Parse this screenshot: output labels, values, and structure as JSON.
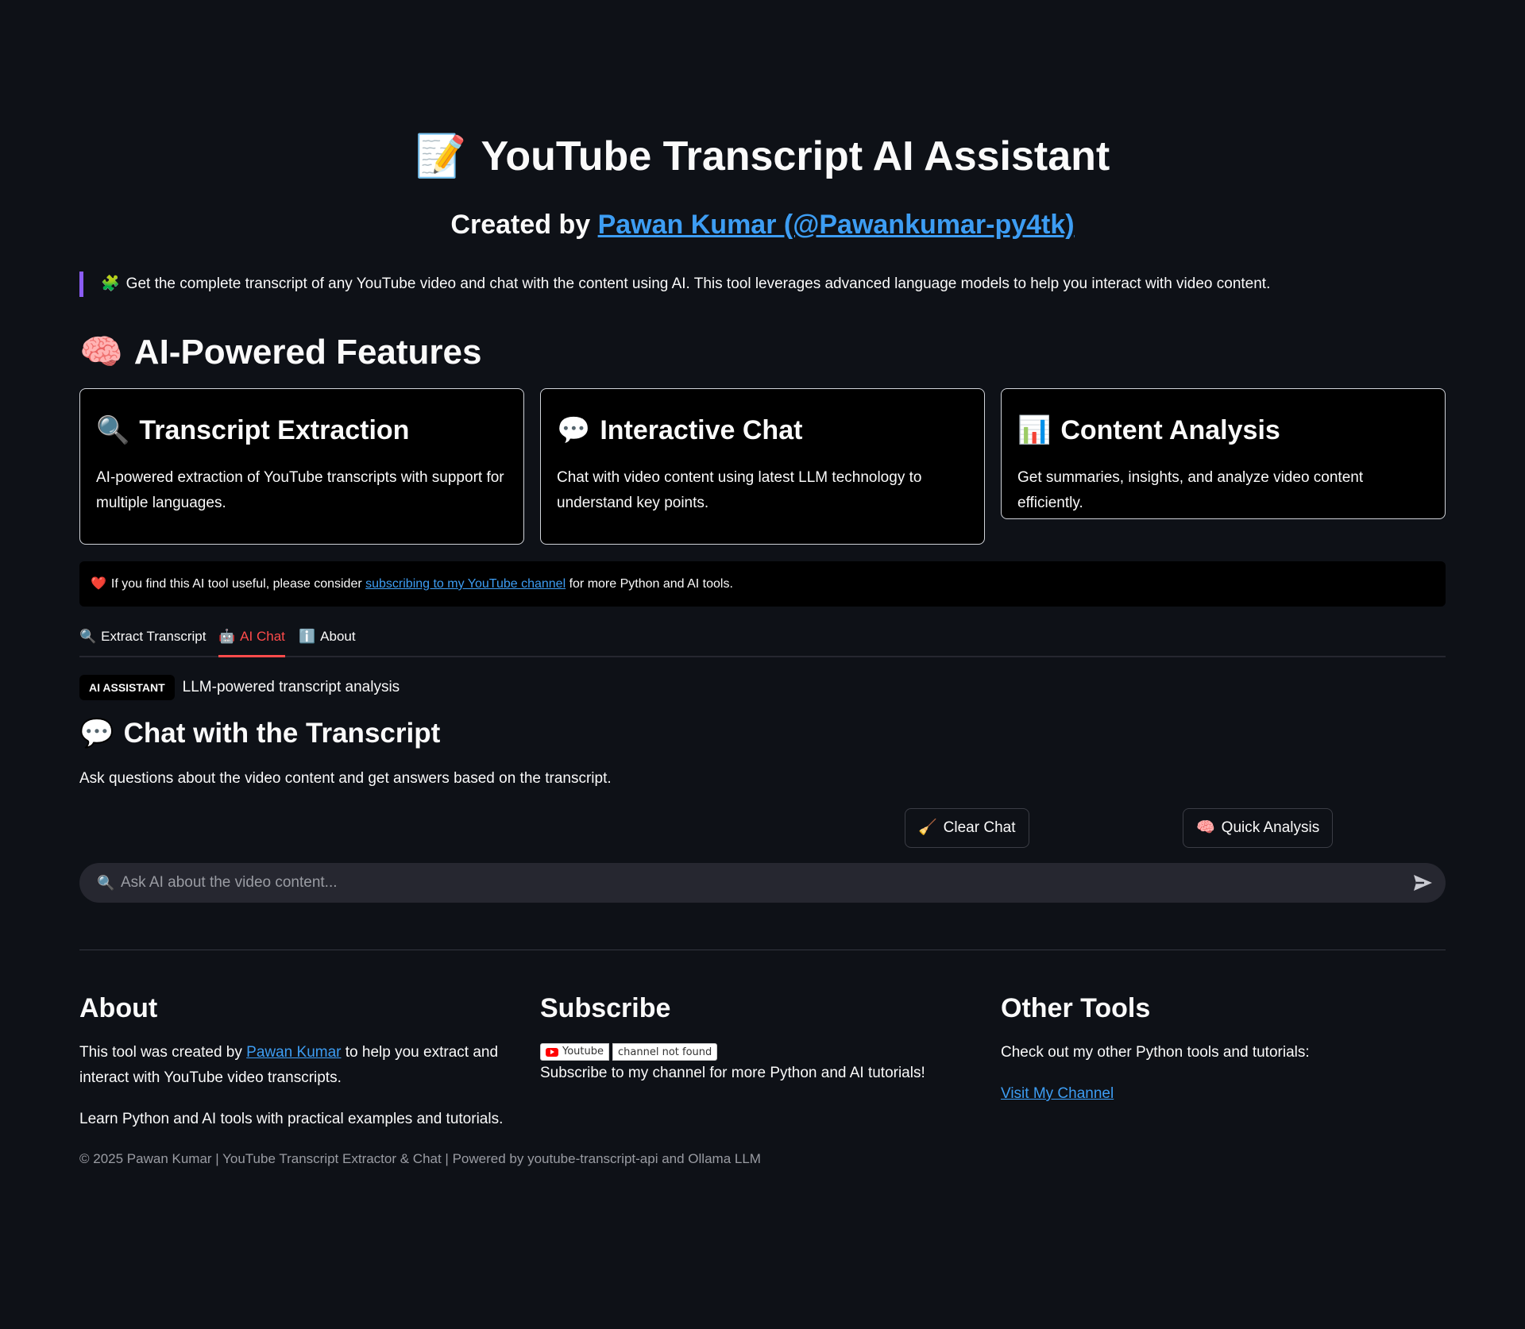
{
  "header": {
    "title_emoji": "📝",
    "title": "YouTube Transcript AI Assistant",
    "created_by_prefix": "Created by ",
    "author_link": "Pawan Kumar (@Pawankumar-py4tk)"
  },
  "intro": {
    "emoji": "🧩",
    "text": "Get the complete transcript of any YouTube video and chat with the content using AI. This tool leverages advanced language models to help you interact with video content."
  },
  "features": {
    "title_emoji": "🧠",
    "title": "AI-Powered Features",
    "cards": [
      {
        "emoji": "🔍",
        "title": "Transcript Extraction",
        "desc": "AI-powered extraction of YouTube transcripts with support for multiple languages."
      },
      {
        "emoji": "💬",
        "title": "Interactive Chat",
        "desc": "Chat with video content using latest LLM technology to understand key points."
      },
      {
        "emoji": "📊",
        "title": "Content Analysis",
        "desc": "Get summaries, insights, and analyze video content efficiently."
      }
    ]
  },
  "banner": {
    "emoji": "❤️",
    "prefix": "If you find this AI tool useful, please consider ",
    "link": "subscribing to my YouTube channel",
    "suffix": " for more Python and AI tools."
  },
  "tabs": [
    {
      "emoji": "🔍",
      "label": "Extract Transcript"
    },
    {
      "emoji": "🤖",
      "label": "AI Chat"
    },
    {
      "emoji": "ℹ️",
      "label": "About"
    }
  ],
  "chat": {
    "badge": "AI ASSISTANT",
    "badge_text": "LLM-powered transcript analysis",
    "title_emoji": "💬",
    "title": "Chat with the Transcript",
    "desc": "Ask questions about the video content and get answers based on the transcript.",
    "clear_emoji": "🧹",
    "clear_label": "Clear Chat",
    "quick_emoji": "🧠",
    "quick_label": "Quick Analysis",
    "input_icon": "🔍",
    "placeholder": "Ask AI about the video content..."
  },
  "footer": {
    "about": {
      "title": "About",
      "p1_prefix": "This tool was created by ",
      "p1_link": "Pawan Kumar",
      "p1_suffix": " to help you extract and interact with YouTube video transcripts.",
      "p2": "Learn Python and AI tools with practical examples and tutorials."
    },
    "subscribe": {
      "title": "Subscribe",
      "shield_left": "Youtube",
      "shield_right": "channel not found",
      "text": "Subscribe to my channel for more Python and AI tutorials!"
    },
    "other": {
      "title": "Other Tools",
      "text": "Check out my other Python tools and tutorials:",
      "link": "Visit My Channel"
    },
    "copyright": "© 2025 Pawan Kumar | YouTube Transcript Extractor & Chat | Powered by youtube-transcript-api and Ollama LLM"
  },
  "colors": {
    "background": "#0e1117",
    "accent": "#ff4b4b",
    "link": "#3d9df3",
    "quote_bar": "#8b5cf6"
  }
}
